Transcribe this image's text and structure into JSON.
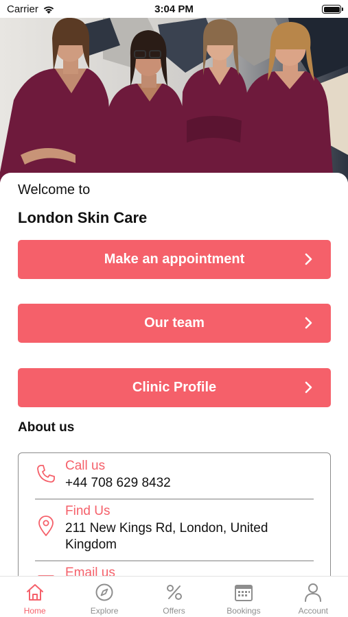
{
  "status_bar": {
    "carrier": "Carrier",
    "time": "3:04 PM"
  },
  "hero": {
    "image": "clinic-team-photo"
  },
  "welcome_text": "Welcome to",
  "clinic_name": "London Skin Care",
  "actions": [
    {
      "label": "Make an appointment"
    },
    {
      "label": "Our team"
    },
    {
      "label": "Clinic Profile"
    }
  ],
  "about": {
    "title": "About us",
    "call_label": "Call us",
    "call_value": "+44 708 629 8432",
    "find_label": "Find Us",
    "find_value": "211 New Kings Rd, London, United Kingdom",
    "email_label": "Email us"
  },
  "tabs": [
    {
      "label": "Home",
      "icon": "home-icon",
      "active": true
    },
    {
      "label": "Explore",
      "icon": "compass-icon",
      "active": false
    },
    {
      "label": "Offers",
      "icon": "percent-icon",
      "active": false
    },
    {
      "label": "Bookings",
      "icon": "calendar-icon",
      "active": false
    },
    {
      "label": "Account",
      "icon": "person-icon",
      "active": false
    }
  ],
  "colors": {
    "accent": "#f5606a",
    "scrubs": "#6e1a3c",
    "tab_inactive": "#8e8e8e"
  }
}
